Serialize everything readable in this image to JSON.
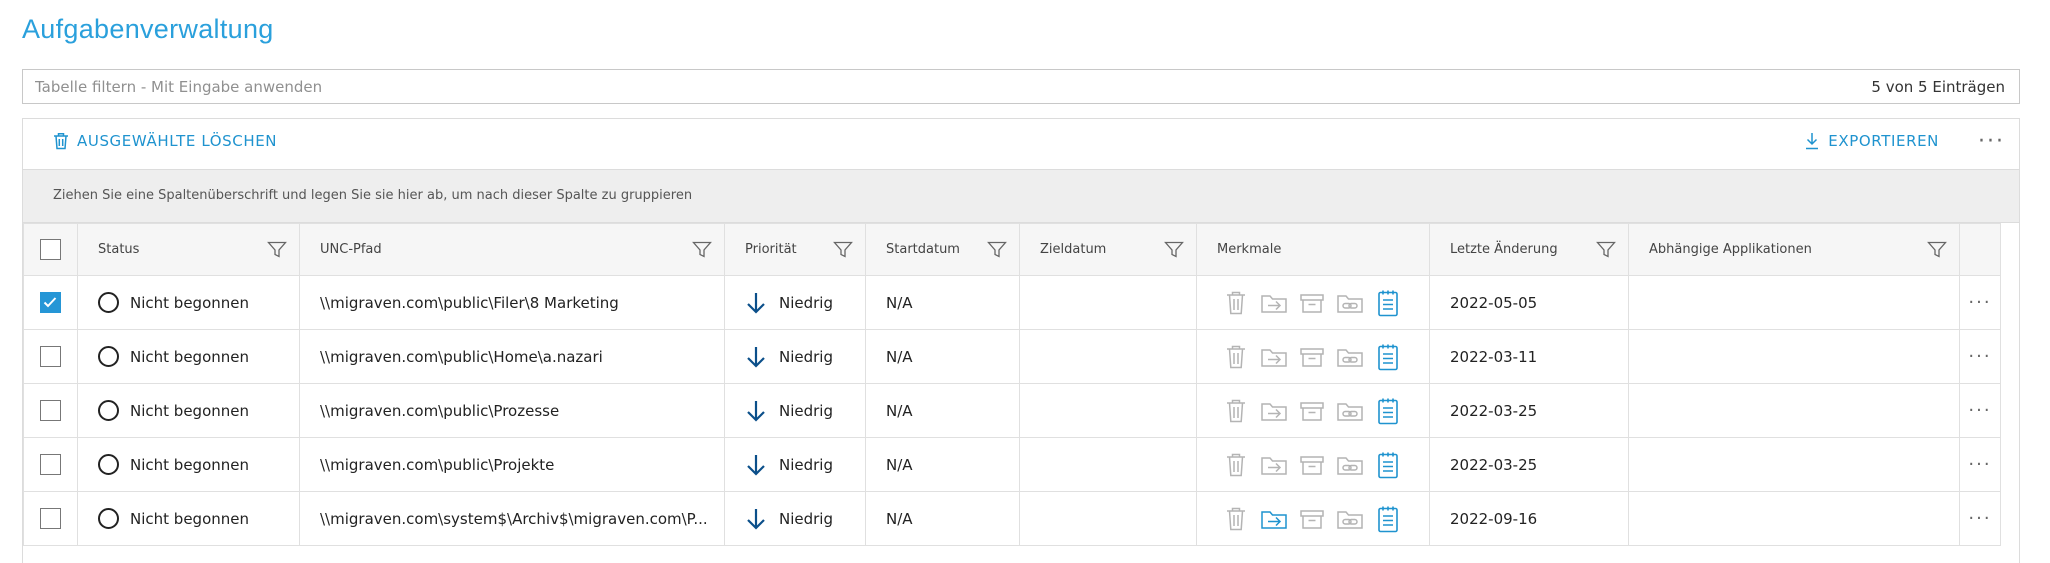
{
  "page": {
    "title": "Aufgabenverwaltung"
  },
  "filter": {
    "placeholder": "Tabelle filtern - Mit Eingabe anwenden",
    "count": "5 von 5 Einträgen"
  },
  "toolbar": {
    "delete_label": "AUSGEWÄHLTE LÖSCHEN",
    "export_label": "EXPORTIEREN",
    "more": "···"
  },
  "group_panel": {
    "text": "Ziehen Sie eine Spaltenüberschrift und legen Sie sie hier ab, um nach dieser Spalte zu gruppieren"
  },
  "columns": {
    "status": "Status",
    "unc": "UNC-Pfad",
    "priority": "Priorität",
    "start": "Startdatum",
    "target": "Zieldatum",
    "features": "Merkmale",
    "changed": "Letzte Änderung",
    "apps": "Abhängige Applikationen"
  },
  "rows": [
    {
      "selected": true,
      "status": "Nicht begonnen",
      "unc": "\\\\migraven.com\\public\\Filer\\8 Marketing",
      "priority": "Niedrig",
      "start": "N/A",
      "target": "",
      "changed": "2022-05-05",
      "apps": "",
      "move_active": false,
      "more": "···"
    },
    {
      "selected": false,
      "status": "Nicht begonnen",
      "unc": "\\\\migraven.com\\public\\Home\\a.nazari",
      "priority": "Niedrig",
      "start": "N/A",
      "target": "",
      "changed": "2022-03-11",
      "apps": "",
      "move_active": false,
      "more": "···"
    },
    {
      "selected": false,
      "status": "Nicht begonnen",
      "unc": "\\\\migraven.com\\public\\Prozesse",
      "priority": "Niedrig",
      "start": "N/A",
      "target": "",
      "changed": "2022-03-25",
      "apps": "",
      "move_active": false,
      "more": "···"
    },
    {
      "selected": false,
      "status": "Nicht begonnen",
      "unc": "\\\\migraven.com\\public\\Projekte",
      "priority": "Niedrig",
      "start": "N/A",
      "target": "",
      "changed": "2022-03-25",
      "apps": "",
      "move_active": false,
      "more": "···"
    },
    {
      "selected": false,
      "status": "Nicht begonnen",
      "unc": "\\\\migraven.com\\system$\\Archiv$\\migraven.com\\P...",
      "priority": "Niedrig",
      "start": "N/A",
      "target": "",
      "changed": "2022-09-16",
      "apps": "",
      "move_active": true,
      "more": "···"
    }
  ],
  "colors": {
    "accent": "#1f93cf",
    "title": "#2aa0dc",
    "priority_arrow": "#0b4f8a",
    "icon_inactive": "#b4b4b4",
    "checkbox_checked": "#2596d6"
  },
  "icons": {
    "delete": "trash-icon",
    "export": "download-icon",
    "filter": "filter-icon",
    "priority": "arrow-down-icon",
    "features": [
      "trash-icon",
      "folder-move-icon",
      "archive-icon",
      "folder-link-icon",
      "task-list-icon"
    ]
  }
}
